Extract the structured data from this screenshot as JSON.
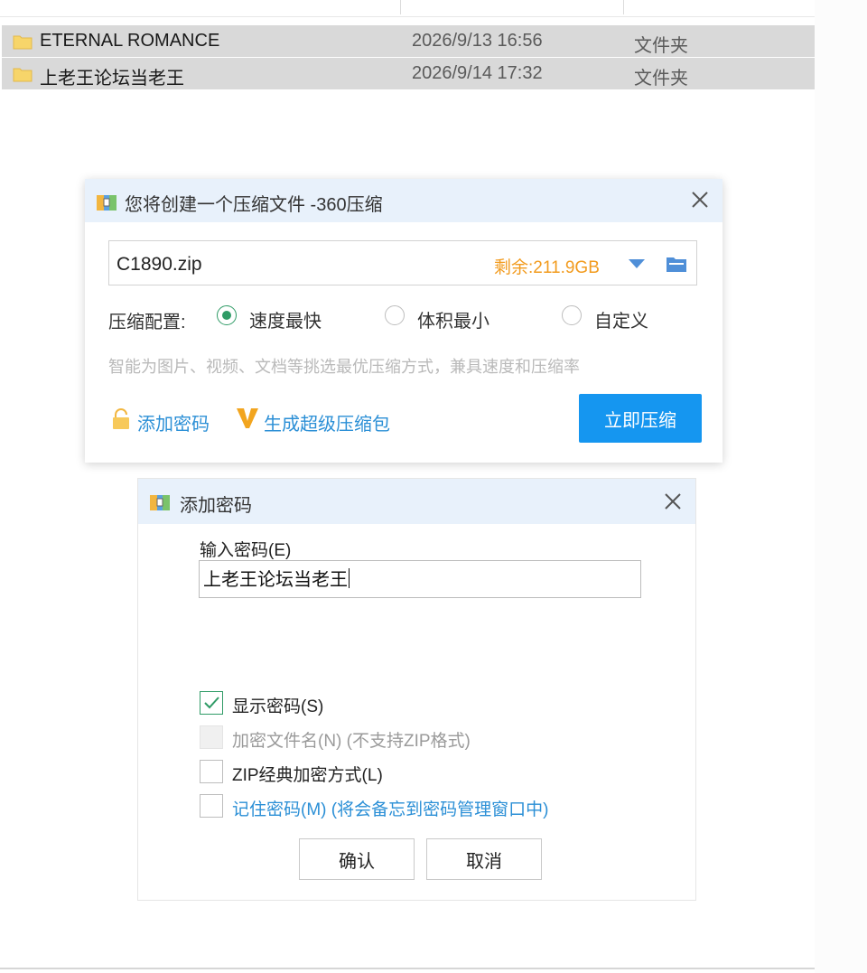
{
  "files": [
    {
      "name": "ETERNAL ROMANCE",
      "date": "2026/9/13 16:56",
      "type": "文件夹"
    },
    {
      "name": "上老王论坛当老王",
      "date": "2026/9/14 17:32",
      "type": "文件夹"
    }
  ],
  "compress_dialog": {
    "title": "您将创建一个压缩文件 -360压缩",
    "file_name": "C1890.zip",
    "free_space": "剩余:211.9GB",
    "config_label": "压缩配置:",
    "options": [
      {
        "label": "速度最快",
        "selected": true
      },
      {
        "label": "体积最小",
        "selected": false
      },
      {
        "label": "自定义",
        "selected": false
      }
    ],
    "hint": "智能为图片、视频、文档等挑选最优压缩方式，兼具速度和压缩率",
    "add_password": "添加密码",
    "super_package": "生成超级压缩包",
    "compress_button": "立即压缩"
  },
  "password_dialog": {
    "title": "添加密码",
    "input_label": "输入密码(E)",
    "password_value": "上老王论坛当老王",
    "checkboxes": [
      {
        "label": "显示密码(S)",
        "checked": true,
        "disabled": false
      },
      {
        "label": "加密文件名(N) (不支持ZIP格式)",
        "checked": false,
        "disabled": true
      },
      {
        "label": "ZIP经典加密方式(L)",
        "checked": false,
        "disabled": false
      },
      {
        "label": "记住密码(M) (将会备忘到密码管理窗口中)",
        "checked": false,
        "disabled": false
      }
    ],
    "confirm_button": "确认",
    "cancel_button": "取消"
  },
  "colors": {
    "accent_blue": "#1596f0",
    "link_blue": "#2b8fd6",
    "free_space_orange": "#f29b1e",
    "check_green": "#2f9b66",
    "titlebar": "#e8f1fb",
    "folder_yellow": "#f7d56a"
  }
}
